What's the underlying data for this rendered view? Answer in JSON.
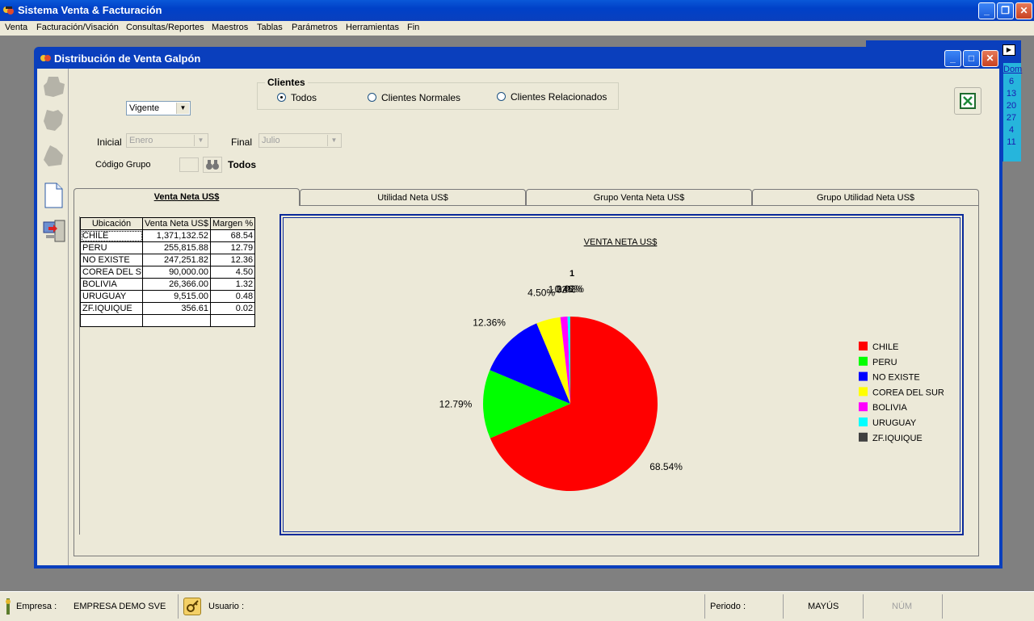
{
  "app": {
    "title": "Sistema Venta & Facturación",
    "menu": [
      "Venta",
      "Facturación/Visación",
      "Consultas/Reportes",
      "Maestros",
      "Tablas",
      "Parámetros",
      "Herramientas",
      "Fin"
    ]
  },
  "calendar": {
    "header": "Dom",
    "days": [
      "6",
      "13",
      "20",
      "27",
      "4",
      "11"
    ]
  },
  "window": {
    "title": "Distribución de Venta Galpón"
  },
  "filters": {
    "state_value": "Vigente",
    "inicial_label": "Inicial",
    "inicial_value": "Enero",
    "final_label": "Final",
    "final_value": "Julio",
    "group_label": "Código Grupo",
    "group_all_label": "Todos",
    "clients_label": "Clientes",
    "client_options": [
      {
        "label": "Todos",
        "selected": true
      },
      {
        "label": "Clientes Normales",
        "selected": false
      },
      {
        "label": "Clientes Relacionados",
        "selected": false
      }
    ]
  },
  "tabs": [
    "Venta Neta US$",
    "Utilidad Neta US$",
    "Grupo Venta Neta US$",
    "Grupo Utilidad Neta US$"
  ],
  "grid": {
    "headers": [
      "Ubicación",
      "Venta Neta US$",
      "Margen %"
    ],
    "rows": [
      [
        "CHILE",
        "1,371,132.52",
        "68.54"
      ],
      [
        "PERU",
        "255,815.88",
        "12.79"
      ],
      [
        "NO EXISTE",
        "247,251.82",
        "12.36"
      ],
      [
        "COREA DEL SUR",
        "90,000.00",
        "4.50"
      ],
      [
        "BOLIVIA",
        "26,366.00",
        "1.32"
      ],
      [
        "URUGUAY",
        "9,515.00",
        "0.48"
      ],
      [
        "ZF.IQUIQUE",
        "356.61",
        "0.02"
      ]
    ]
  },
  "chart_data": {
    "type": "pie",
    "title": "VENTA NETA US$",
    "subtitle": "1",
    "categories": [
      "CHILE",
      "PERU",
      "NO EXISTE",
      "COREA DEL SUR",
      "BOLIVIA",
      "URUGUAY",
      "ZF.IQUIQUE"
    ],
    "values": [
      68.54,
      12.79,
      12.36,
      4.5,
      1.32,
      0.48,
      0.02
    ],
    "slice_labels": [
      "68.54%",
      "12.79%",
      "12.36%",
      "4.50%",
      "1.32%",
      "0.48%",
      "0.02%"
    ],
    "colors": [
      "#ff0000",
      "#00ff00",
      "#0000ff",
      "#ffff00",
      "#ff00ff",
      "#00ffff",
      "#404040"
    ],
    "legend_position": "right"
  },
  "status": {
    "empresa_label": "Empresa :",
    "empresa_value": "EMPRESA DEMO SVE",
    "usuario_label": "Usuario :",
    "periodo_label": "Periodo :",
    "mayus": "MAYÚS",
    "num": "NÚM"
  }
}
